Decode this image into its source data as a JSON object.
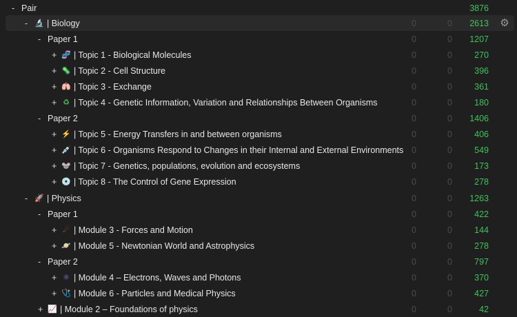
{
  "root": {
    "toggle": "-",
    "label": "Pair",
    "c1": "",
    "c2": "",
    "c3": "3876"
  },
  "rows": [
    {
      "toggle": "-",
      "icon": "microscope-icon",
      "glyph": "🔬",
      "label": "| Biology",
      "c1": "0",
      "c2": "0",
      "c3": "2613"
    },
    {
      "toggle": "-",
      "label": "Paper 1",
      "c1": "0",
      "c2": "0",
      "c3": "1207"
    },
    {
      "toggle": "+",
      "icon": "dna-icon",
      "glyph": "🧬",
      "label": "| Topic 1 - Biological Molecules",
      "c1": "0",
      "c2": "0",
      "c3": "270"
    },
    {
      "toggle": "+",
      "icon": "cell-icon",
      "glyph": "🦠",
      "label": "| Topic 2 - Cell Structure",
      "c1": "0",
      "c2": "0",
      "c3": "396"
    },
    {
      "toggle": "+",
      "icon": "lungs-icon",
      "glyph": "🫁",
      "label": "| Topic 3 - Exchange",
      "c1": "0",
      "c2": "0",
      "c3": "361"
    },
    {
      "toggle": "+",
      "icon": "recycle-icon",
      "glyph": "♻",
      "label": "| Topic 4 - Genetic Information, Variation and Relationships Between Organisms",
      "c1": "0",
      "c2": "0",
      "c3": "180"
    },
    {
      "toggle": "-",
      "label": "Paper 2",
      "c1": "0",
      "c2": "0",
      "c3": "1406"
    },
    {
      "toggle": "+",
      "icon": "lightning-icon",
      "glyph": "⚡",
      "label": "| Topic 5 - Energy Transfers in and between organisms",
      "c1": "0",
      "c2": "0",
      "c3": "406"
    },
    {
      "toggle": "+",
      "icon": "syringe-icon",
      "glyph": "💉",
      "label": "| Topic 6 - Organisms Respond to Changes in their Internal and External Environments",
      "c1": "0",
      "c2": "0",
      "c3": "549"
    },
    {
      "toggle": "+",
      "icon": "mouse-icon",
      "glyph": "🐭",
      "label": "| Topic 7 - Genetics, populations, evolution and ecosystems",
      "c1": "0",
      "c2": "0",
      "c3": "173"
    },
    {
      "toggle": "+",
      "icon": "disc-icon",
      "glyph": "💿",
      "label": "| Topic 8 - The Control of Gene Expression",
      "c1": "0",
      "c2": "0",
      "c3": "278"
    },
    {
      "toggle": "-",
      "icon": "rocket-icon",
      "glyph": "🚀",
      "label": "| Physics",
      "c1": "0",
      "c2": "0",
      "c3": "1263"
    },
    {
      "toggle": "-",
      "label": "Paper 1",
      "c1": "0",
      "c2": "0",
      "c3": "422"
    },
    {
      "toggle": "+",
      "icon": "meteor-icon",
      "glyph": "☄",
      "label": "| Module 3 - Forces and Motion",
      "c1": "0",
      "c2": "0",
      "c3": "144"
    },
    {
      "toggle": "+",
      "icon": "planet-icon",
      "glyph": "🪐",
      "label": "| Module 5 - Newtonian World and Astrophysics",
      "c1": "0",
      "c2": "0",
      "c3": "278"
    },
    {
      "toggle": "-",
      "label": "Paper 2",
      "c1": "0",
      "c2": "0",
      "c3": "797"
    },
    {
      "toggle": "+",
      "icon": "atom-icon",
      "glyph": "⚛",
      "label": "| Module 4 – Electrons, Waves and Photons",
      "c1": "0",
      "c2": "0",
      "c3": "370"
    },
    {
      "toggle": "+",
      "icon": "stethoscope-icon",
      "glyph": "🩺",
      "label": "| Module 6 - Particles and Medical Physics",
      "c1": "0",
      "c2": "0",
      "c3": "427"
    },
    {
      "toggle": "+",
      "icon": "chart-icon",
      "glyph": "📈",
      "label": "| Module 2 – Foundations of physics",
      "c1": "0",
      "c2": "0",
      "c3": "42"
    }
  ],
  "colors": {
    "background": "#1f1f1f",
    "count_green": "#3ec35a",
    "count_zero": "#4c4c4c",
    "selected_row": "#2a2a2a"
  },
  "settings_icon": "gear-icon"
}
